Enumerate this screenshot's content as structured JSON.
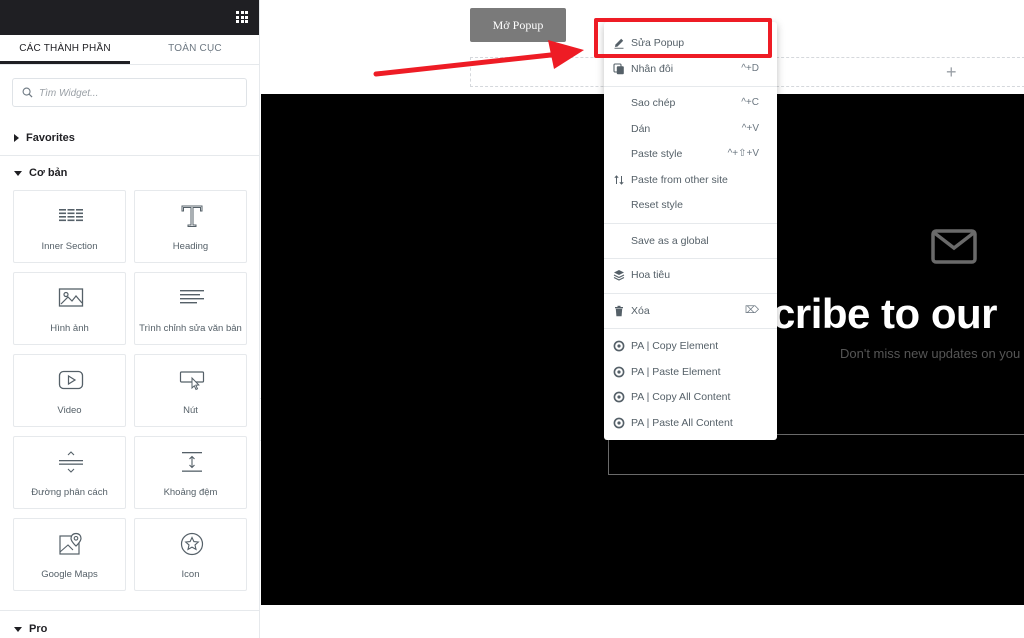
{
  "panel": {
    "tabs": [
      {
        "label": "CÁC THÀNH PHẦN",
        "active": true
      },
      {
        "label": "TOÀN CỤC",
        "active": false
      }
    ],
    "search_placeholder": "Tìm Widget...",
    "sections": {
      "favorites": "Favorites",
      "basic": "Cơ bản",
      "pro": "Pro"
    },
    "widgets": [
      {
        "label": "Inner Section",
        "icon": "inner-section-icon"
      },
      {
        "label": "Heading",
        "icon": "heading-icon"
      },
      {
        "label": "Hình ảnh",
        "icon": "image-icon"
      },
      {
        "label": "Trình chỉnh sửa văn bản",
        "icon": "text-editor-icon"
      },
      {
        "label": "Video",
        "icon": "video-icon"
      },
      {
        "label": "Nút",
        "icon": "button-icon"
      },
      {
        "label": "Đường phân cách",
        "icon": "divider-icon"
      },
      {
        "label": "Khoảng đệm",
        "icon": "spacer-icon"
      },
      {
        "label": "Google Maps",
        "icon": "google-maps-icon"
      },
      {
        "label": "Icon",
        "icon": "star-icon"
      }
    ]
  },
  "canvas": {
    "open_button": "Mở Popup",
    "heading": "cribe to our",
    "subtext": "Don't miss new updates on you"
  },
  "context_menu": {
    "items": [
      {
        "label": "Sửa Popup",
        "shortcut": "",
        "icon": "pencil-icon"
      },
      {
        "label": "Nhân đôi",
        "shortcut": "^+D",
        "icon": "duplicate-icon"
      },
      {
        "label": "Sao chép",
        "shortcut": "^+C",
        "icon": ""
      },
      {
        "label": "Dán",
        "shortcut": "^+V",
        "icon": ""
      },
      {
        "label": "Paste style",
        "shortcut": "^+⇧+V",
        "icon": ""
      },
      {
        "label": "Paste from other site",
        "shortcut": "",
        "icon": "swap-arrows-icon"
      },
      {
        "label": "Reset style",
        "shortcut": "",
        "icon": ""
      },
      {
        "label": "Save as a global",
        "shortcut": "",
        "icon": ""
      },
      {
        "label": "Hoa tiêu",
        "shortcut": "",
        "icon": "layers-icon"
      },
      {
        "label": "Xóa",
        "shortcut": "⌦",
        "icon": "trash-icon"
      },
      {
        "label": "PA | Copy Element",
        "shortcut": "",
        "icon": "pa-icon"
      },
      {
        "label": "PA | Paste Element",
        "shortcut": "",
        "icon": "pa-icon"
      },
      {
        "label": "PA | Copy All Content",
        "shortcut": "",
        "icon": "pa-icon"
      },
      {
        "label": "PA | Paste All Content",
        "shortcut": "",
        "icon": "pa-icon"
      }
    ]
  },
  "colors": {
    "panel_header": "#1f1f23",
    "highlight": "#ee1c25",
    "button_bg": "#7a7a7a",
    "section_bg": "#000000"
  }
}
